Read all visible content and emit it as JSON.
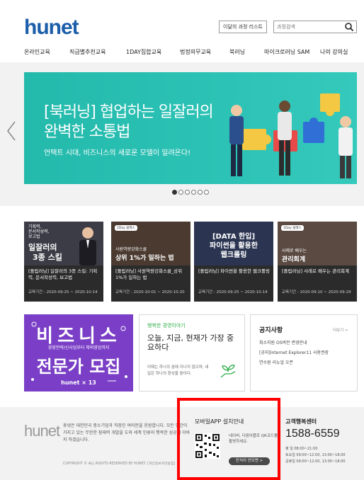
{
  "header": {
    "logo_text": "hunet",
    "course_list_button": "이달의 과정 리스트",
    "search_placeholder": "과정검색"
  },
  "nav": {
    "items": [
      "온라인교육",
      "직급별추천교육",
      "1DAY집합교육",
      "법정의무교육",
      "북러닝",
      "마이크로러닝 SAM",
      "나의 강의실"
    ]
  },
  "hero": {
    "title_line1": "[북러닝] 협업하는 일잘러의",
    "title_line2": "완벽한 소통법",
    "subtitle": "언택트 시대, 비즈니스의 새로운 모델이 밀려온다!",
    "background_color": "#2cbfb2",
    "slide_count": 6,
    "active_slide": 1
  },
  "courses": [
    {
      "thumb_text": [
        "일잘러의",
        "3종 스킬"
      ],
      "thumb_tags": [
        "기획력,",
        "문서작성력,",
        "보고법"
      ],
      "title": "[플립러닝] 일잘러의 3종 스킬: 기획력, 문서작성력, 보고법",
      "period": "교육기간 : 2020-09-25 ~ 2020-10-14"
    },
    {
      "thumb_badge": "1Day 클래스",
      "thumb_text": [
        "사원역량강화스쿨",
        "상위 1%가 일하는 법"
      ],
      "title": "[플립러닝] 사원역량강화스쿨_상위 1%가 일하는 법",
      "period": "교육기간 : 2020-10-01 ~ 2020-10-20"
    },
    {
      "thumb_text": [
        "[DATA 한입]",
        "파이썬을 활용한",
        "웹크롤링"
      ],
      "title": "[플립러닝] 파이썬을 활용한 웹크롤링",
      "period": "교육기간 : 2020-09-25 ~ 2020-10-14"
    },
    {
      "thumb_badge": "1Day 클래스",
      "thumb_text": [
        "사례로 배우는",
        "관리회계"
      ],
      "title": "[플립러닝] 사례로 배우는 관리회계",
      "period": "교육기간 : 2020-09-10 ~ 2020-09-29"
    }
  ],
  "biz_banner": {
    "title": "비즈니스",
    "sub": "경영전략/신사업부터 해외영업까지",
    "big": "전문가 모집",
    "logo": "hunet × 13"
  },
  "story": {
    "label": "행복한 경영이야기",
    "title_line1": "오늘, 지금, 현재가 가장 중",
    "title_line2": "요하다",
    "body": "어제는 하나의 꿈에 지나지 않으며, 내일은 하나의 환상을 뿐이다."
  },
  "notice": {
    "title": "공지사항",
    "more": "더보기 >",
    "items": [
      "최소지원 OS버전 변경안내",
      "[공지]Internet Explorer11 사용권장",
      "연수원 리뉴얼 오픈"
    ]
  },
  "footer": {
    "logo": "hunet",
    "description": "휴넷은 대한민국 중소기업과 직장인 여러분을 응원합니다. 모든 인간이 가지고 있는 무한한 잠재력 개발을 도와 세계 인류의 행복한 성공에 이바지 하겠습니다.",
    "copyright": "COPYRIGHT © ALL RIGHTS RESERVED BY HUNET. [개인정보처리방침]"
  },
  "app": {
    "title": "모바일APP 설치안내",
    "description": "네이버, 다음어플로 QR코드를 촬영하세요.",
    "button": "인식이 안되면 >"
  },
  "customer_center": {
    "title": "고객행복센터",
    "phone": "1588-6559",
    "hours": [
      "평  일   08:00~21:00",
      "토요일   09:00~12:00, 13:00~18:00",
      "공휴일   09:00~12:00, 13:00~18:00"
    ]
  },
  "colors": {
    "brand_blue": "#1b5ea9",
    "brand_red": "#e8262f",
    "highlight_red": "#ff0000",
    "banner_purple": "#7a3fc6",
    "story_green": "#2fae4a"
  }
}
